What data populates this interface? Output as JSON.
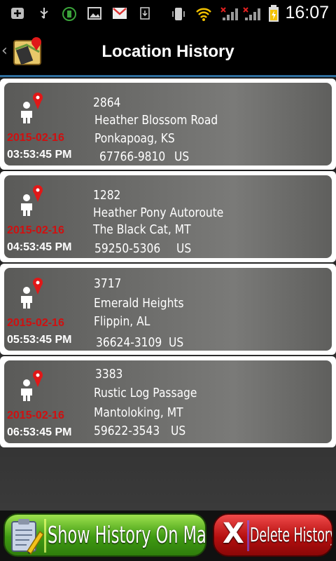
{
  "status_bar": {
    "time": "16:07",
    "icons": [
      "add-icon",
      "usb-icon",
      "battery-app-icon",
      "picture-icon",
      "gmail-icon",
      "download-icon",
      "vibrate-icon",
      "wifi-icon",
      "signal-icon",
      "signal-icon",
      "battery-charging-icon"
    ]
  },
  "header": {
    "title": "Location History"
  },
  "entries": [
    {
      "number": "2864",
      "street": "Heather Blossom Road",
      "city_state": "Ponkapoag, KS",
      "zip": "67766-9810",
      "country": "US",
      "date": "2015-02-16",
      "time": "03:53:45 PM"
    },
    {
      "number": "1282",
      "street": "Heather Pony Autoroute",
      "city_state": "The Black Cat, MT",
      "zip": "59250-5306",
      "country": "US",
      "date": "2015-02-16",
      "time": "04:53:45 PM"
    },
    {
      "number": "3717",
      "street": "Emerald Heights",
      "city_state": "Flippin, AL",
      "zip": "36624-3109",
      "country": "US",
      "date": "2015-02-16",
      "time": "05:53:45 PM"
    },
    {
      "number": "3383",
      "street": "Rustic Log Passage",
      "city_state": "Mantoloking, MT",
      "zip": "59622-3543",
      "country": "US",
      "date": "2015-02-16",
      "time": "06:53:45 PM"
    }
  ],
  "buttons": {
    "show_map": "Show History On Map",
    "delete_icon_text": "X",
    "delete": "Delete History"
  },
  "colors": {
    "date_red": "#d01010",
    "accent_blue": "#2e6e9e",
    "map_button_green": "#3f9a12",
    "delete_button_red": "#b50f0f"
  }
}
